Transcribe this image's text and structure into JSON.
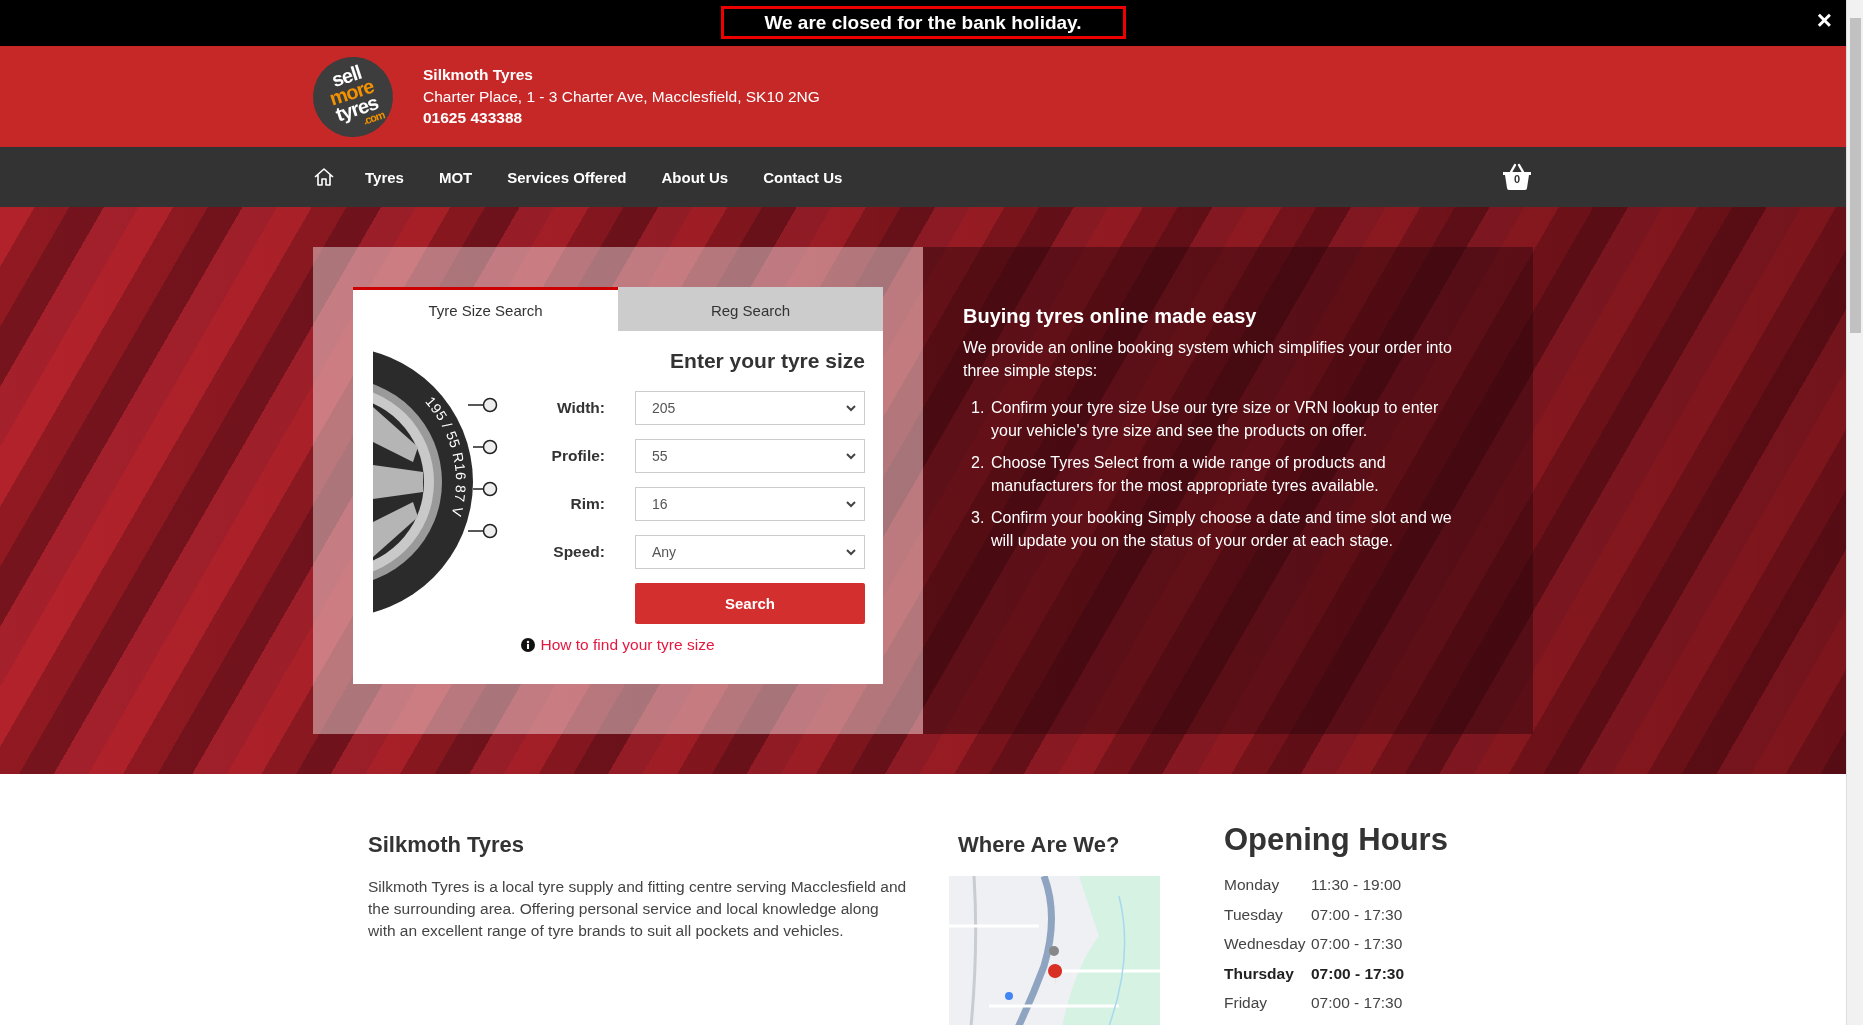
{
  "notice": {
    "text": "We are closed for the bank holiday.",
    "close": "×"
  },
  "logo": {
    "lines": [
      {
        "text": "sell",
        "color": "#ffffff"
      },
      {
        "text": "more",
        "color": "#f39200"
      },
      {
        "text": "tyres",
        "color": "#ffffff"
      },
      {
        "text": ".com",
        "color": "#f39200"
      }
    ]
  },
  "business": {
    "name": "Silkmoth Tyres",
    "address": "Charter Place, 1 - 3 Charter Ave, Macclesfield, SK10 2NG",
    "phone": "01625 433388"
  },
  "nav": {
    "items": [
      {
        "label": "Tyres"
      },
      {
        "label": "MOT"
      },
      {
        "label": "Services Offered"
      },
      {
        "label": "About Us"
      },
      {
        "label": "Contact Us"
      }
    ],
    "basket_count": "0"
  },
  "search_card": {
    "tabs": [
      {
        "label": "Tyre Size Search",
        "selected": true
      },
      {
        "label": "Reg Search",
        "selected": false
      }
    ],
    "tyre_marking": "195 / 55 R16 87 V",
    "heading": "Enter your tyre size",
    "fields": [
      {
        "label": "Width:",
        "value": "205"
      },
      {
        "label": "Profile:",
        "value": "55"
      },
      {
        "label": "Rim:",
        "value": "16"
      },
      {
        "label": "Speed:",
        "value": "Any"
      }
    ],
    "button": "Search",
    "help_link": "How to find your tyre size"
  },
  "intro": {
    "heading": "Buying tyres online made easy",
    "text": "We provide an online booking system which simplifies your order into three simple steps:",
    "steps": [
      {
        "number": "1.",
        "text": "Confirm your tyre size Use our tyre size or VRN lookup to enter your vehicle's tyre size and see the products on offer."
      },
      {
        "number": "2.",
        "text": "Choose Tyres Select from a wide range of products and manufacturers for the most appropriate tyres available."
      },
      {
        "number": "3.",
        "text": "Confirm your booking Simply choose a date and time slot and we will update you on the status of your order at each stage."
      }
    ]
  },
  "about": {
    "heading": "Silkmoth Tyres",
    "text": "Silkmoth Tyres is a local tyre supply and fitting centre serving Macclesfield and the surrounding area. Offering personal service and local knowledge along with an excellent range of tyre brands to suit all pockets and vehicles."
  },
  "location": {
    "heading": "Where Are We?"
  },
  "opening_hours": {
    "heading": "Opening Hours",
    "days": [
      {
        "day": "Monday",
        "hours": "11:30 - 19:00",
        "today": false
      },
      {
        "day": "Tuesday",
        "hours": "07:00 - 17:30",
        "today": false
      },
      {
        "day": "Wednesday",
        "hours": "07:00 - 17:30",
        "today": false
      },
      {
        "day": "Thursday",
        "hours": "07:00 - 17:30",
        "today": true
      },
      {
        "day": "Friday",
        "hours": "07:00 - 17:30",
        "today": false
      }
    ]
  }
}
